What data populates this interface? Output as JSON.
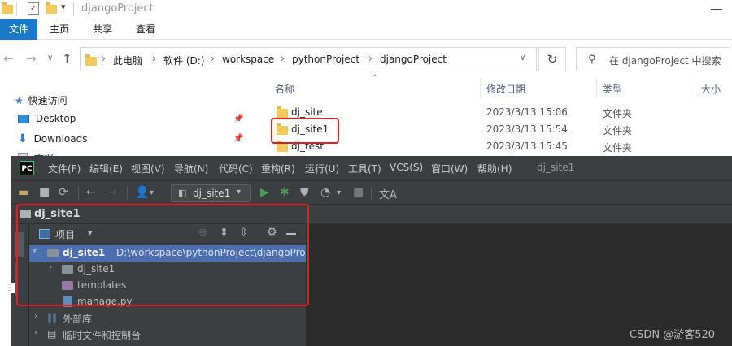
{
  "explorer": {
    "window_title": "djangoProject",
    "ribbon_tabs": [
      "文件",
      "主页",
      "共享",
      "查看"
    ],
    "address": [
      "此电脑",
      "软件 (D:)",
      "workspace",
      "pythonProject",
      "djangoProject"
    ],
    "search_placeholder": "在 djangoProject 中搜索",
    "sidebar": {
      "quick_access": "快速访问",
      "items": [
        "Desktop",
        "Downloads",
        "文档"
      ]
    },
    "columns": [
      "名称",
      "修改日期",
      "类型",
      "大小"
    ],
    "files": [
      {
        "name": "dj_site",
        "date": "2023/3/13 15:06",
        "type": "文件夹"
      },
      {
        "name": "dj_site1",
        "date": "2023/3/13 15:54",
        "type": "文件夹"
      },
      {
        "name": "dj_test",
        "date": "2023/3/13 15:45",
        "type": "文件夹"
      }
    ],
    "colors": {
      "ribbon_active": "#1979ca",
      "folder": "#f5c95a",
      "highlight": "#e02020"
    }
  },
  "pycharm": {
    "logo": "PC",
    "menu": [
      "文件(F)",
      "编辑(E)",
      "视图(V)",
      "导航(N)",
      "代码(C)",
      "重构(R)",
      "运行(U)",
      "工具(T)",
      "VCS(S)",
      "窗口(W)",
      "帮助(H)"
    ],
    "window_title": "dj_site1",
    "run_config": "dj_site1",
    "nav_crumb": "dj_site1",
    "project_panel": {
      "label": "项目",
      "root_name": "dj_site1",
      "root_path": "D:\\workspace\\pythonProject\\djangoProject",
      "children": [
        "dj_site1",
        "templates",
        "manage.py"
      ],
      "external": [
        "外部库",
        "临时文件和控制台"
      ]
    },
    "left_strip_text": "3"
  },
  "watermark": "CSDN @游客520"
}
